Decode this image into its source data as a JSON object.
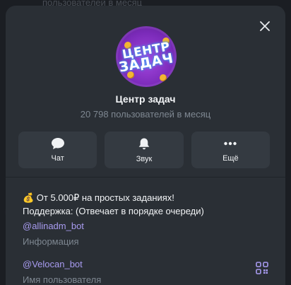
{
  "background": {
    "top_text": "пользователей в месяц"
  },
  "profile": {
    "avatar": {
      "line1": "ЦЕНТР",
      "line2": "ЗАДАЧ"
    },
    "name": "Центр задач",
    "subscribers": "20 798 пользователей в месяц"
  },
  "actions": [
    {
      "label": "Чат",
      "icon": "chat-bubble-icon"
    },
    {
      "label": "Звук",
      "icon": "bell-icon"
    },
    {
      "label": "Ещё",
      "icon": "more-dots-icon"
    }
  ],
  "info": {
    "emoji": "💰",
    "line1": " От 5.000₽ на простых заданиях!",
    "line2": "Поддержка: (Отвечает в порядке очереди)",
    "support_link": "@allinadm_bot",
    "section_label": "Информация"
  },
  "username": {
    "value": "@Velocan_bot",
    "label": "Имя пользователя"
  },
  "colors": {
    "panel": "#2a2f35",
    "action_button": "#343a41",
    "link": "#a89bf0",
    "muted_text": "#7e8791",
    "avatar": "#a546e0"
  }
}
